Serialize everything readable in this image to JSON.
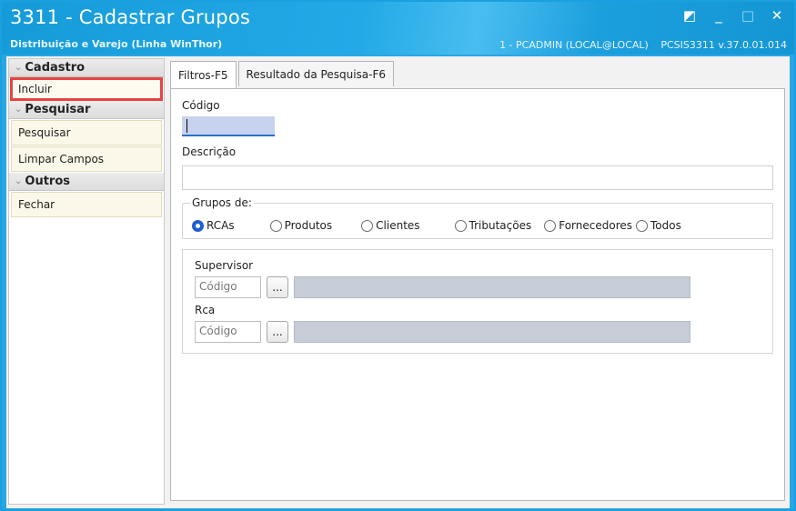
{
  "window": {
    "title": "3311 - Cadastrar Grupos",
    "subtitle": "Distribuição e Varejo (Linha WinThor)",
    "user_info": "1 - PCADMIN (LOCAL@LOCAL)",
    "program_info": "PCSIS3311  v.37.0.01.014",
    "buttons": {
      "restore": "◩",
      "minimize": "_",
      "maximize": "□",
      "close": "✕"
    }
  },
  "sidebar": {
    "groups": [
      {
        "title": "Cadastro",
        "items": [
          "Incluir"
        ]
      },
      {
        "title": "Pesquisar",
        "items": [
          "Pesquisar",
          "Limpar Campos"
        ]
      },
      {
        "title": "Outros",
        "items": [
          "Fechar"
        ]
      }
    ]
  },
  "tabs": [
    "Filtros-F5",
    "Resultado da Pesquisa-F6"
  ],
  "form": {
    "codigo_label": "Código",
    "codigo_value": "",
    "descricao_label": "Descrição",
    "descricao_value": "",
    "grupos_legend": "Grupos de:",
    "grupos_options": [
      "RCAs",
      "Produtos",
      "Clientes",
      "Tributações",
      "Fornecedores",
      "Todos"
    ],
    "grupos_selected": "RCAs",
    "supervisor_label": "Supervisor",
    "supervisor_placeholder": "Código",
    "rca_label": "Rca",
    "rca_placeholder": "Código",
    "lookup_button": "..."
  },
  "colors": {
    "titlebar": "#1a9fdc",
    "highlight_border": "#e84343",
    "radio_selected": "#1f5fcf"
  }
}
